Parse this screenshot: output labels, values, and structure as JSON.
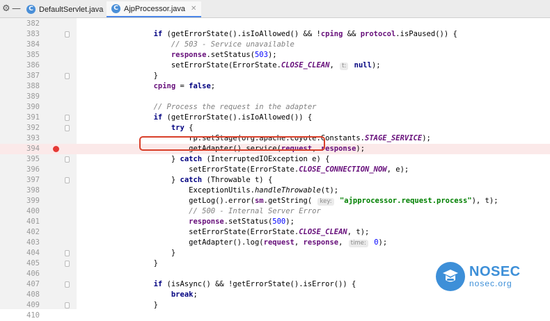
{
  "tabbar": {
    "tabs": [
      {
        "label": "DefaultServlet.java",
        "icon": "c-class-icon",
        "active": false
      },
      {
        "label": "AjpProcessor.java",
        "icon": "c-class-icon",
        "active": true
      }
    ]
  },
  "editor": {
    "breakpoint_line": 394,
    "highlight_color": "#fbe9e9",
    "box_color": "#d8402a",
    "lines": [
      {
        "n": "382",
        "segs": []
      },
      {
        "n": "383",
        "fold": true,
        "segs": [
          {
            "t": "        "
          },
          {
            "t": "if",
            "c": "kw"
          },
          {
            "t": " (getErrorState().isIoAllowed() && !"
          },
          {
            "t": "cping",
            "c": "fd"
          },
          {
            "t": " && "
          },
          {
            "t": "protocol",
            "c": "fd"
          },
          {
            "t": ".isPaused()) {"
          }
        ]
      },
      {
        "n": "384",
        "segs": [
          {
            "t": "            "
          },
          {
            "t": "// 503 - Service unavailable",
            "c": "cm"
          }
        ]
      },
      {
        "n": "385",
        "segs": [
          {
            "t": "            "
          },
          {
            "t": "response",
            "c": "fd"
          },
          {
            "t": ".setStatus("
          },
          {
            "t": "503",
            "c": "nu"
          },
          {
            "t": ");"
          }
        ]
      },
      {
        "n": "386",
        "segs": [
          {
            "t": "            setErrorState(ErrorState."
          },
          {
            "t": "CLOSE_CLEAN",
            "c": "cn"
          },
          {
            "t": ", "
          },
          {
            "t": "t:",
            "c": "hint"
          },
          {
            "t": " "
          },
          {
            "t": "null",
            "c": "kw"
          },
          {
            "t": ");"
          }
        ]
      },
      {
        "n": "387",
        "fold": true,
        "segs": [
          {
            "t": "        }"
          }
        ]
      },
      {
        "n": "388",
        "segs": [
          {
            "t": "        "
          },
          {
            "t": "cping",
            "c": "fd"
          },
          {
            "t": " = "
          },
          {
            "t": "false",
            "c": "kw"
          },
          {
            "t": ";"
          }
        ]
      },
      {
        "n": "389",
        "segs": []
      },
      {
        "n": "390",
        "segs": [
          {
            "t": "        "
          },
          {
            "t": "// Process the request in the adapter",
            "c": "cm"
          }
        ]
      },
      {
        "n": "391",
        "fold": true,
        "segs": [
          {
            "t": "        "
          },
          {
            "t": "if",
            "c": "kw"
          },
          {
            "t": " (getErrorState().isIoAllowed()) {"
          }
        ]
      },
      {
        "n": "392",
        "fold": true,
        "segs": [
          {
            "t": "            "
          },
          {
            "t": "try",
            "c": "kw"
          },
          {
            "t": " {"
          }
        ]
      },
      {
        "n": "393",
        "segs": [
          {
            "t": "                rp.setStage(org.apache.coyote.Constants."
          },
          {
            "t": "STAGE_SERVICE",
            "c": "cn"
          },
          {
            "t": ");"
          }
        ]
      },
      {
        "n": "394",
        "hl": true,
        "segs": [
          {
            "t": "                getAdapter().service("
          },
          {
            "t": "request",
            "c": "fd"
          },
          {
            "t": ", "
          },
          {
            "t": "response",
            "c": "fd"
          },
          {
            "t": ");"
          }
        ]
      },
      {
        "n": "395",
        "fold": true,
        "segs": [
          {
            "t": "            } "
          },
          {
            "t": "catch",
            "c": "kw"
          },
          {
            "t": " (InterruptedIOException e) {"
          }
        ]
      },
      {
        "n": "396",
        "segs": [
          {
            "t": "                setErrorState(ErrorState."
          },
          {
            "t": "CLOSE_CONNECTION_NOW",
            "c": "cn"
          },
          {
            "t": ", e);"
          }
        ]
      },
      {
        "n": "397",
        "fold": true,
        "segs": [
          {
            "t": "            } "
          },
          {
            "t": "catch",
            "c": "kw"
          },
          {
            "t": " (Throwable t) {"
          }
        ]
      },
      {
        "n": "398",
        "segs": [
          {
            "t": "                ExceptionUtils."
          },
          {
            "t": "handleThrowable",
            "c": "it"
          },
          {
            "t": "(t);"
          }
        ]
      },
      {
        "n": "399",
        "segs": [
          {
            "t": "                getLog().error("
          },
          {
            "t": "sm",
            "c": "fd"
          },
          {
            "t": ".getString( "
          },
          {
            "t": "key:",
            "c": "hint"
          },
          {
            "t": " "
          },
          {
            "t": "\"ajpprocessor.request.process\"",
            "c": "st"
          },
          {
            "t": "), t);"
          }
        ]
      },
      {
        "n": "400",
        "segs": [
          {
            "t": "                "
          },
          {
            "t": "// 500 - Internal Server Error",
            "c": "cm"
          }
        ]
      },
      {
        "n": "401",
        "segs": [
          {
            "t": "                "
          },
          {
            "t": "response",
            "c": "fd"
          },
          {
            "t": ".setStatus("
          },
          {
            "t": "500",
            "c": "nu"
          },
          {
            "t": ");"
          }
        ]
      },
      {
        "n": "402",
        "segs": [
          {
            "t": "                setErrorState(ErrorState."
          },
          {
            "t": "CLOSE_CLEAN",
            "c": "cn"
          },
          {
            "t": ", t);"
          }
        ]
      },
      {
        "n": "403",
        "segs": [
          {
            "t": "                getAdapter().log("
          },
          {
            "t": "request",
            "c": "fd"
          },
          {
            "t": ", "
          },
          {
            "t": "response",
            "c": "fd"
          },
          {
            "t": ", "
          },
          {
            "t": "time:",
            "c": "hint"
          },
          {
            "t": " "
          },
          {
            "t": "0",
            "c": "nu"
          },
          {
            "t": ");"
          }
        ]
      },
      {
        "n": "404",
        "fold": true,
        "segs": [
          {
            "t": "            }"
          }
        ]
      },
      {
        "n": "405",
        "fold": true,
        "segs": [
          {
            "t": "        }"
          }
        ]
      },
      {
        "n": "406",
        "segs": []
      },
      {
        "n": "407",
        "fold": true,
        "segs": [
          {
            "t": "        "
          },
          {
            "t": "if",
            "c": "kw"
          },
          {
            "t": " (isAsync() && !getErrorState().isError()) {"
          }
        ]
      },
      {
        "n": "408",
        "segs": [
          {
            "t": "            "
          },
          {
            "t": "break",
            "c": "kw"
          },
          {
            "t": ";"
          }
        ]
      },
      {
        "n": "409",
        "fold": true,
        "segs": [
          {
            "t": "        }"
          }
        ]
      },
      {
        "n": "410",
        "segs": []
      }
    ]
  },
  "watermark": {
    "name": "NOSEC",
    "url": "nosec.org",
    "color": "#3d8fd8"
  }
}
